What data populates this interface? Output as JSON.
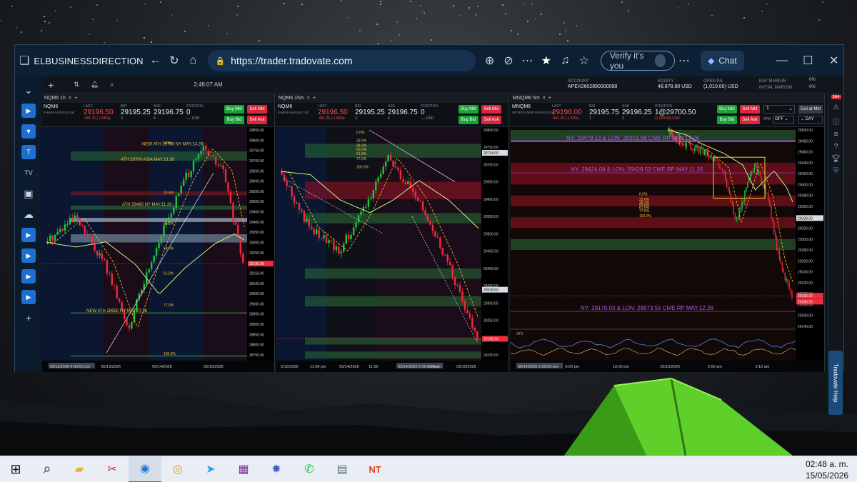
{
  "browser": {
    "title": "ELBUSINESSDIRECTION CAPITAL L",
    "url": "https://trader.tradovate.com",
    "verify_label": "Verify it's you",
    "chat_label": "Chat"
  },
  "app": {
    "time": "2:48:07 AM",
    "account": {
      "label": "ACCOUNT",
      "value": "APEX2602890000098"
    },
    "equity": {
      "label": "EQUITY",
      "value": "48,878.88 USD"
    },
    "open_pl": {
      "label": "OPEN P/L",
      "value": "(1,010.00) USD"
    },
    "day_margin": {
      "label": "DAY MARGIN",
      "value": "0%"
    },
    "initial_margin": {
      "label": "INITIAL MARGIN",
      "value": "0%"
    },
    "help_label": "Tradovate Help",
    "badge": "364"
  },
  "panels": [
    {
      "tab": "NQM6 1h",
      "symbol": "NQM6",
      "desc": "E-MINI NASDAQ 100",
      "last": "29196.50",
      "change": "-491.25 (-1.65%)",
      "bid": "29195.25",
      "bid_size": "3",
      "ask": "29196.75",
      "ask_size": "4",
      "position": "0",
      "position_sub": "-,-- USD",
      "buttons": [
        "Buy Mkt",
        "Sell Mkt",
        "Buy Bid",
        "Sell Ask"
      ],
      "price_labels": [
        "29850.00",
        "29800.00",
        "29750.00",
        "29700.00",
        "29650.00",
        "29600.00",
        "29550.00",
        "29500.00",
        "29450.00",
        "29400.00",
        "29350.00",
        "29300.00",
        "29250.00",
        "29200.00",
        "29150.00",
        "29100.00",
        "29050.00",
        "29000.00",
        "28950.00",
        "28900.00",
        "28850.00",
        "28800.00",
        "28750.00"
      ],
      "time_labels": [
        "05/11/2026 4:00:00 pm",
        "05/13/2026",
        "05/14/2026",
        "05/15/2026"
      ],
      "annotations": [
        "NEW ATH  29780 NY MAY.14.26",
        "ATH  29700 ASIA MAY.13.26",
        "ATH  29480 NY MAY.11.26",
        "NEW ATH 28950 NY MAY.07.26"
      ],
      "fib": [
        "0.0%",
        "23.6%",
        "38.2%",
        "50.0%",
        "61.8%",
        "77.0%",
        "100.0%"
      ],
      "last_tag": "29196.50"
    },
    {
      "tab": "NQM6 15m",
      "symbol": "NQM6",
      "desc": "E-MINI NASDAQ 100",
      "last": "29196.50",
      "change": "-491.25 (-1.65%)",
      "bid": "29195.25",
      "bid_size": "3",
      "ask": "29196.75",
      "ask_size": "4",
      "position": "0",
      "position_sub": "-,-- USD",
      "buttons": [
        "Buy Mkt",
        "Sell Mkt",
        "Buy Bid",
        "Sell Ask"
      ],
      "price_labels": [
        "29800.00",
        "29750.00",
        "29700.00",
        "29650.00",
        "29600.00",
        "29550.00",
        "29500.00",
        "29450.00",
        "29400.00",
        "29350.00",
        "29300.00",
        "29250.00",
        "29200.00",
        "29150.00"
      ],
      "time_labels": [
        "5/13/2026",
        "11:00 pm",
        "05/14/2026",
        "11:00",
        "05/14/2026 5:00:00 pm",
        "1:00 pm",
        "05/15/2026"
      ],
      "fib": [
        "0.0%",
        "23.6%",
        "38.2%",
        "50.0%",
        "61.8%",
        "77.0%",
        "100.0%"
      ],
      "tags": [
        "29734.00",
        "29338.50",
        "29196.50"
      ]
    },
    {
      "tab": "MNQM6 5m",
      "symbol": "MNQM6",
      "desc": "MICRO E-MINI NASDAQ 100",
      "last": "29196.00",
      "change": "-491.25 (-1.66%)",
      "bid": "29195.75",
      "bid_size": "1",
      "ask": "29196.25",
      "ask_size": "3",
      "position": "1@29700.50",
      "position_sub": "(1,009.50) USD",
      "buttons": [
        "Buy Mkt",
        "Sell Mkt",
        "Buy Bid",
        "Sell Ask"
      ],
      "qty": "1",
      "exit_label": "Exit at Mkt",
      "atm_label": "ATM",
      "atm_value": "OFF",
      "day_label": "DAY",
      "price_labels": [
        "29500.00",
        "29480.00",
        "29460.00",
        "29440.00",
        "29420.00",
        "29400.00",
        "29380.00",
        "29360.00",
        "29340.00",
        "29320.00",
        "29300.00",
        "29280.00",
        "29260.00",
        "29240.00",
        "29220.00",
        "29200.00",
        "29180.00",
        "29160.00",
        "29140.00"
      ],
      "time_labels": [
        "05/14/2026 5:05:00 pm",
        "8:00 pm",
        "10:00 pm",
        "05/15/2026",
        "2:00 am",
        "3:15 am"
      ],
      "annotations": [
        "NY: 29479.13 & LON: 29301.98  CME RP MAY.13.26",
        "NY: 29424.08  & LON:  29429.52  CME RP MAY.11.26",
        "NY: 29170.03 & LON: 28873.55  CME RP MAY.12.26"
      ],
      "fib": [
        "0.0%",
        "23.6%",
        "38.2%",
        "50.0%",
        "61.8%",
        "77.0%",
        "100.0%"
      ],
      "tags": [
        "29338.50",
        "29196.00",
        "29185.25"
      ],
      "atr_label": "ATR",
      "atr_value": "28"
    }
  ],
  "taskbar": {
    "time": "02:48 a. m.",
    "date": "15/05/2026"
  }
}
